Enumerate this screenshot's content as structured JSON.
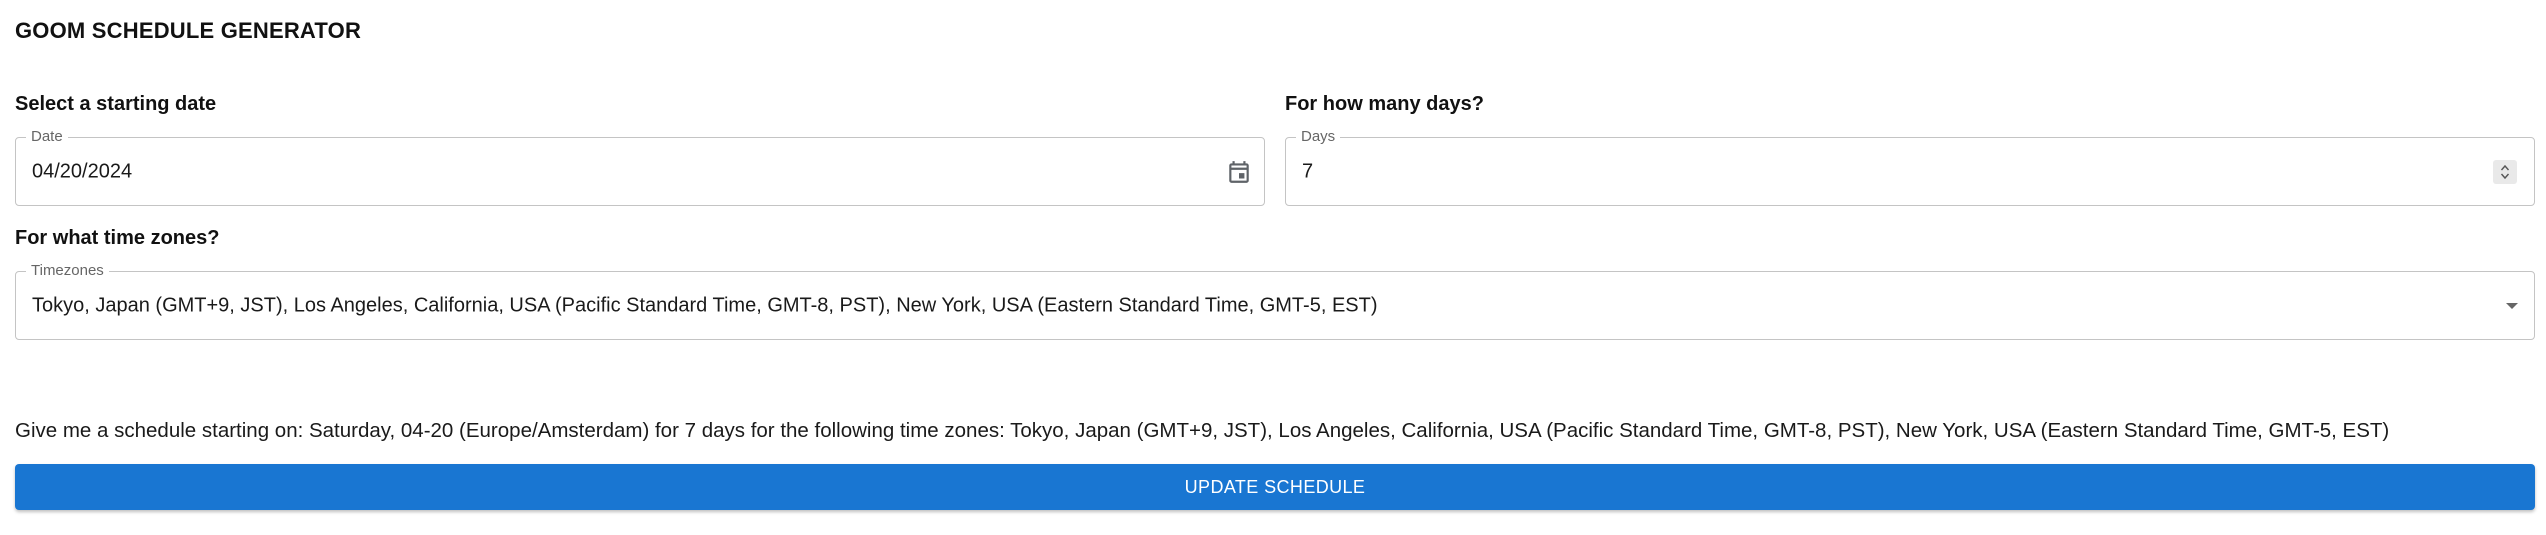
{
  "app": {
    "title": "GOOM SCHEDULE GENERATOR"
  },
  "start_date": {
    "section_label": "Select a starting date",
    "field_label": "Date",
    "value": "04/20/2024",
    "icon": "calendar-icon"
  },
  "days": {
    "section_label": "For how many days?",
    "field_label": "Days",
    "value": "7",
    "icon": "number-stepper-icon"
  },
  "timezones": {
    "section_label": "For what time zones?",
    "field_label": "Timezones",
    "value": "Tokyo, Japan (GMT+9, JST), Los Angeles, California, USA (Pacific Standard Time, GMT-8, PST), New York, USA (Eastern Standard Time, GMT-5, EST)",
    "icon": "dropdown-arrow-icon"
  },
  "summary": {
    "text": "Give me a schedule starting on: Saturday, 04-20 (Europe/Amsterdam) for 7 days for the following time zones: Tokyo, Japan (GMT+9, JST), Los Angeles, California, USA (Pacific Standard Time, GMT-8, PST), New York, USA (Eastern Standard Time, GMT-5, EST)"
  },
  "actions": {
    "update_label": "UPDATE SCHEDULE"
  },
  "colors": {
    "primary": "#1976d2",
    "border": "#c4c4c4",
    "label_muted": "#666666"
  }
}
